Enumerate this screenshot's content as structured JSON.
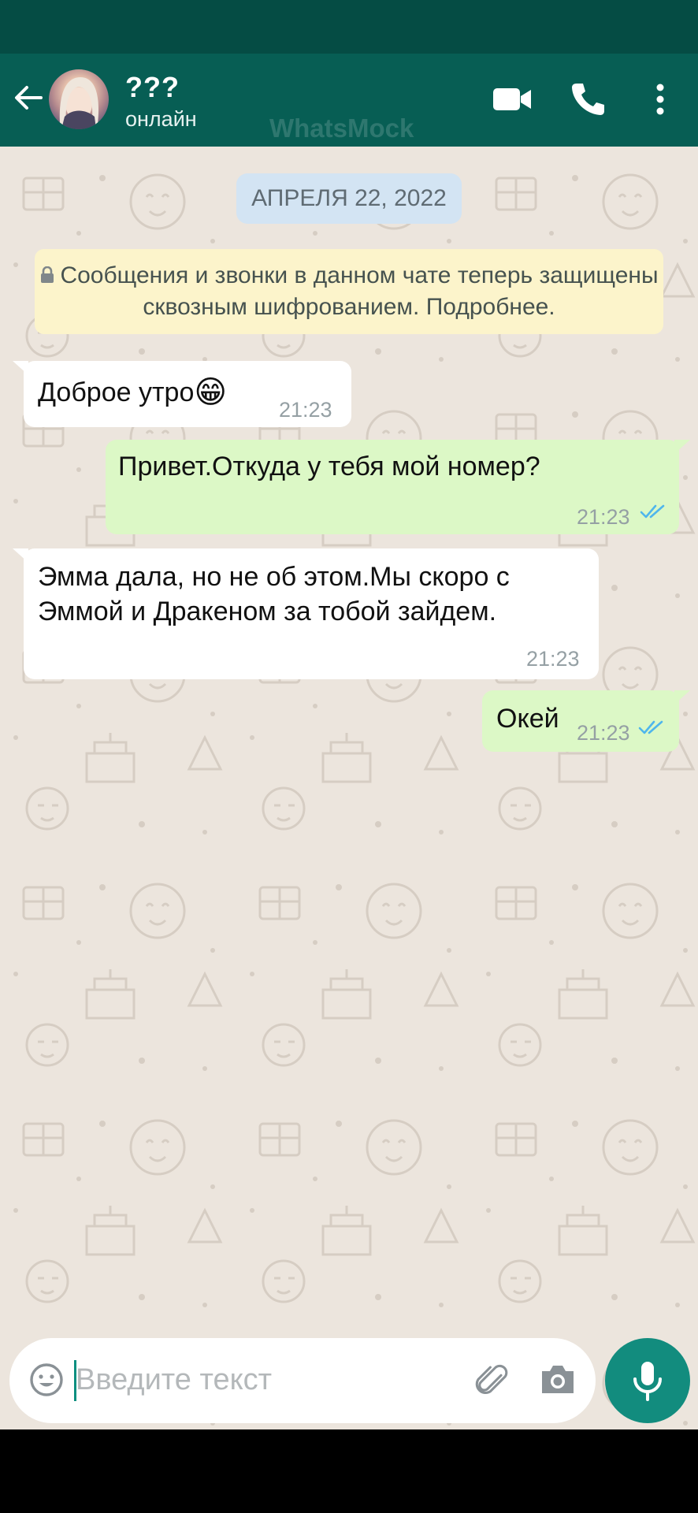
{
  "header": {
    "contact_name": "???",
    "status": "онлайн",
    "watermark": "WhatsMock",
    "icons": [
      "back-arrow-icon",
      "video-call-icon",
      "phone-icon",
      "more-vert-icon"
    ]
  },
  "chat": {
    "date_chip": "АПРЕЛЯ 22, 2022",
    "e2e_notice": "Сообщения и звонки в данном чате теперь защищены сквозным шифрованием. Подробнее.",
    "messages": [
      {
        "direction": "in",
        "text": "Доброе утро",
        "emoji": "😁",
        "time": "21:23"
      },
      {
        "direction": "out",
        "text": "Привет.Откуда у тебя мой номер?",
        "time": "21:23",
        "status": "read"
      },
      {
        "direction": "in",
        "text": "Эмма дала, но не об этом.Мы скоро с\nЭммой и Дракеном за тобой зайдем.",
        "time": "21:23"
      },
      {
        "direction": "out",
        "text": "Окей",
        "time": "21:23",
        "status": "read"
      }
    ]
  },
  "composer": {
    "placeholder": "Введите текст"
  },
  "colors": {
    "header": "#075e54",
    "status_bar": "#054c44",
    "chat_bg": "#ece5dd",
    "bubble_out": "#dcf8c6",
    "bubble_in": "#ffffff",
    "read_tick": "#4fb6ec",
    "mic_button": "#128c7e"
  }
}
